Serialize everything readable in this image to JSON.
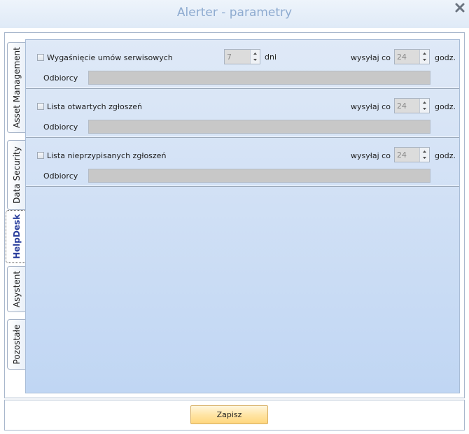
{
  "window": {
    "title": "Alerter - parametry"
  },
  "tabs": [
    {
      "label": "Asset Management"
    },
    {
      "label": "Data Security"
    },
    {
      "label": "HelpDesk",
      "active": true
    },
    {
      "label": "Asystent"
    },
    {
      "label": "Pozostałe"
    }
  ],
  "sections": [
    {
      "checkbox_label": "Wygaśnięcie umów serwisowych",
      "checked": false,
      "days_value": "7",
      "days_unit": "dni",
      "send_every_label": "wysyłaj co",
      "hours_value": "24",
      "hours_unit": "godz.",
      "recipients_label": "Odbiorcy",
      "recipients_value": ""
    },
    {
      "checkbox_label": "Lista otwartych zgłoszeń",
      "checked": false,
      "send_every_label": "wysyłaj co",
      "hours_value": "24",
      "hours_unit": "godz.",
      "recipients_label": "Odbiorcy",
      "recipients_value": ""
    },
    {
      "checkbox_label": "Lista nieprzypisanych zgłoszeń",
      "checked": false,
      "send_every_label": "wysyłaj co",
      "hours_value": "24",
      "hours_unit": "godz.",
      "recipients_label": "Odbiorcy",
      "recipients_value": ""
    }
  ],
  "footer": {
    "save_label": "Zapisz"
  },
  "icons": {
    "close": "close-x-icon",
    "spin_up": "spin-up-arrow-icon",
    "spin_down": "spin-down-arrow-icon"
  },
  "colors": {
    "content_top": "#dfe9f7",
    "content_bottom": "#c0d6f3",
    "save_button": "#ffd77e",
    "title_text": "#8eabd0"
  }
}
